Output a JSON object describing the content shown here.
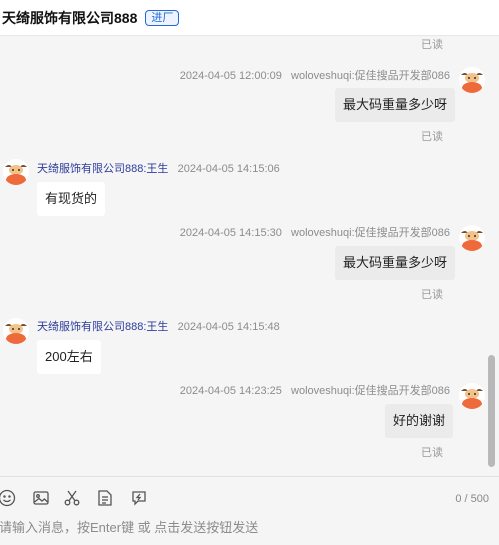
{
  "header": {
    "title": "天绮服饰有限公司888",
    "badge": "进厂"
  },
  "messages": [
    {
      "read": "已读"
    },
    {
      "sender": "woloveshuqi:促佳搜品开发部086",
      "time": "2024-04-05 12:00:09",
      "text": "最大码重量多少呀",
      "read": "已读"
    },
    {
      "sender": "天绮服饰有限公司888:王生",
      "time": "2024-04-05 14:15:06",
      "text": "有现货的"
    },
    {
      "sender": "woloveshuqi:促佳搜品开发部086",
      "time": "2024-04-05 14:15:30",
      "text": "最大码重量多少呀",
      "read": "已读"
    },
    {
      "sender": "天绮服饰有限公司888:王生",
      "time": "2024-04-05 14:15:48",
      "text": "200左右"
    },
    {
      "sender": "woloveshuqi:促佳搜品开发部086",
      "time": "2024-04-05 14:23:25",
      "text": "好的谢谢",
      "read": "已读"
    }
  ],
  "toolbar": {
    "icons": [
      "emoji-icon",
      "image-icon",
      "scissors-icon",
      "document-icon",
      "quick-reply-icon"
    ],
    "counter": "0 / 500"
  },
  "input": {
    "placeholder": "请输入消息，按Enter键 或 点击发送按钮发送"
  },
  "colors": {
    "bubble_self": "#ebebeb",
    "bubble_other": "#ffffff",
    "sender_name": "#2d3c9b",
    "badge": "#2468d8"
  }
}
